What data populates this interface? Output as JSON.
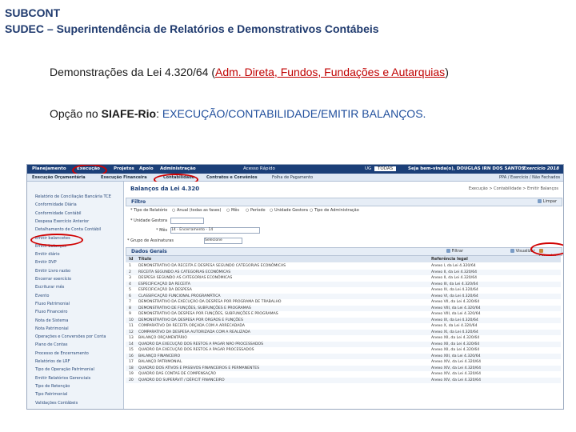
{
  "header": {
    "line1": "SUBCONT",
    "line2": "SUDEC – Superintendência de Relatórios e Demonstrativos Contábeis"
  },
  "body": {
    "line1_prefix": "Demonstrações da Lei 4.320/64 (",
    "line1_highlight": "Adm. Direta, Fundos, Fundações e Autarquias",
    "line1_suffix": ")",
    "line2_prefix": "Opção no ",
    "line2_bold": "SIAFE-Rio",
    "line2_sep": ": ",
    "line2_path": "EXECUÇÃO/CONTABILIDADE/EMITIR BALANÇOS."
  },
  "app": {
    "menu": [
      "Planejamento",
      "Execução",
      "Projetos",
      "Apoio",
      "Administração"
    ],
    "quick": "Acesso Rápido",
    "ug": "UG",
    "ug_value": "TODAS",
    "welcome": "Seja bem-vinda(o), DOUGLAS IRN DOS SANTOS",
    "exercise": "Exercício 2018",
    "subtabs": [
      "Execução Orçamentária",
      "Execução Financeira",
      "Contabilidade",
      "Contratos e Convênios",
      "Folha de Pagamento"
    ],
    "ppa": "PPA / Exercício / Não Fechados",
    "sidebar": [
      "Relatório de Conciliação Bancária TCE",
      "Conformidade Diária",
      "Conformidade Contábil",
      "Despesa Exercício Anterior",
      "Detalhamento de Conta Contábil",
      "Emitir balancetes",
      "Emitir balanços",
      "Emitir diário",
      "Emitir DVP",
      "Emitir Livro razão",
      "Encerrar exercício",
      "Escriturar mês",
      "Evento",
      "Fluxo Patrimonial",
      "Fluxo Financeiro",
      "Nota de Sistema",
      "Nota Patrimonial",
      "Operações e Conversões por Conta",
      "Plano de Contas",
      "Processo de Encerramento",
      "Relatórios de LRF",
      "Tipo de Operação Patrimonial",
      "Emitir Relatórios Gerenciais",
      "Tipo de Retenção",
      "Tipo Patrimonial",
      "Validações Contábeis"
    ],
    "title": "Balanços da Lei 4.320",
    "breadcrumb": "Execução > Contabilidade > Emitir Balanços",
    "filter": "Filtro",
    "clear": "Limpar",
    "type_label": "* Tipo de Relatório",
    "type_options": [
      "Anual (todas as fases)",
      "Mês",
      "Período",
      "Unidade Gestora",
      "Tipo de Administração"
    ],
    "unit_label": "* Unidade Gestora",
    "month_label": "* Mês",
    "month_value": "14 - Encerramento - 14",
    "group_label": "* Grupo de Assinaturas",
    "group_value": "Selecione",
    "grid_title": "Dados Gerais",
    "filter_btn": "Filtrar",
    "view_btn": "Visualizar",
    "export_btn": "Executar",
    "cols": [
      "Id",
      "Título",
      "Referência legal"
    ],
    "rows": [
      [
        "1",
        "DEMONSTRATIVO DA RECEITA E DESPESA SEGUNDO CATEGORIAS ECONÔMICAS",
        "Anexo I, da Lei 4.320/64"
      ],
      [
        "2",
        "RECEITA SEGUNDO AS CATEGORIAS ECONÔMICAS",
        "Anexo II, da Lei 4.320/64"
      ],
      [
        "3",
        "DESPESA SEGUNDO AS CATEGORIAS ECONÔMICAS",
        "Anexo II, da Lei 4.320/64"
      ],
      [
        "4",
        "ESPECIFICAÇÃO DA RECEITA",
        "Anexo III, da Lei 4.320/64"
      ],
      [
        "5",
        "ESPECIFICAÇÃO DA DESPESA",
        "Anexo IV, da Lei 4.320/64"
      ],
      [
        "6",
        "CLASSIFICAÇÃO FUNCIONAL PROGRAMÁTICA",
        "Anexo VI, da Lei 4.320/64"
      ],
      [
        "7",
        "DEMONSTRATIVO DA EXECUÇÃO DA DESPESA POR PROGRAMA DE TRABALHO",
        "Anexo VII, da Lei 4.320/64"
      ],
      [
        "8",
        "DEMONSTRATIVO DE FUNÇÕES, SUBFUNÇÕES E PROGRAMAS",
        "Anexo VIII, da Lei 4.320/64"
      ],
      [
        "9",
        "DEMONSTRATIVO DA DESPESA POR FUNÇÕES, SUBFUNÇÕES E PROGRAMAS",
        "Anexo VIII, da Lei 4.320/64"
      ],
      [
        "10",
        "DEMONSTRATIVO DA DESPESA POR ÓRGÃOS E FUNÇÕES",
        "Anexo IX, da Lei 4.320/64"
      ],
      [
        "11",
        "COMPARATIVO DA RECEITA ORÇADA COM A ARRECADADA",
        "Anexo X, da Lei 4.320/64"
      ],
      [
        "12",
        "COMPARATIVO DA DESPESA AUTORIZADA COM A REALIZADA",
        "Anexo XI, da Lei 4.320/64"
      ],
      [
        "13",
        "BALANÇO ORÇAMENTÁRIO",
        "Anexo XII, da Lei 4.320/64"
      ],
      [
        "14",
        "QUADRO DA EXECUÇÃO DOS RESTOS A PAGAR NÃO PROCESSADOS",
        "Anexo XII, da Lei 4.320/64"
      ],
      [
        "15",
        "QUADRO DA EXECUÇÃO DOS RESTOS A PAGAR PROCESSADOS",
        "Anexo XII, da Lei 4.320/64"
      ],
      [
        "16",
        "BALANÇO FINANCEIRO",
        "Anexo XIII, da Lei 4.320/64"
      ],
      [
        "17",
        "BALANÇO PATRIMONIAL",
        "Anexo XIV, da Lei 4.320/64"
      ],
      [
        "18",
        "QUADRO DOS ATIVOS E PASSIVOS FINANCEIROS E PERMANENTES",
        "Anexo XIV, da Lei 4.320/64"
      ],
      [
        "19",
        "QUADRO DAS CONTAS DE COMPENSAÇÃO",
        "Anexo XIV, da Lei 4.320/64"
      ],
      [
        "20",
        "QUADRO DO SUPERÁVIT / DÉFICIT FINANCEIRO",
        "Anexo XIV, da Lei 4.320/64"
      ]
    ]
  }
}
